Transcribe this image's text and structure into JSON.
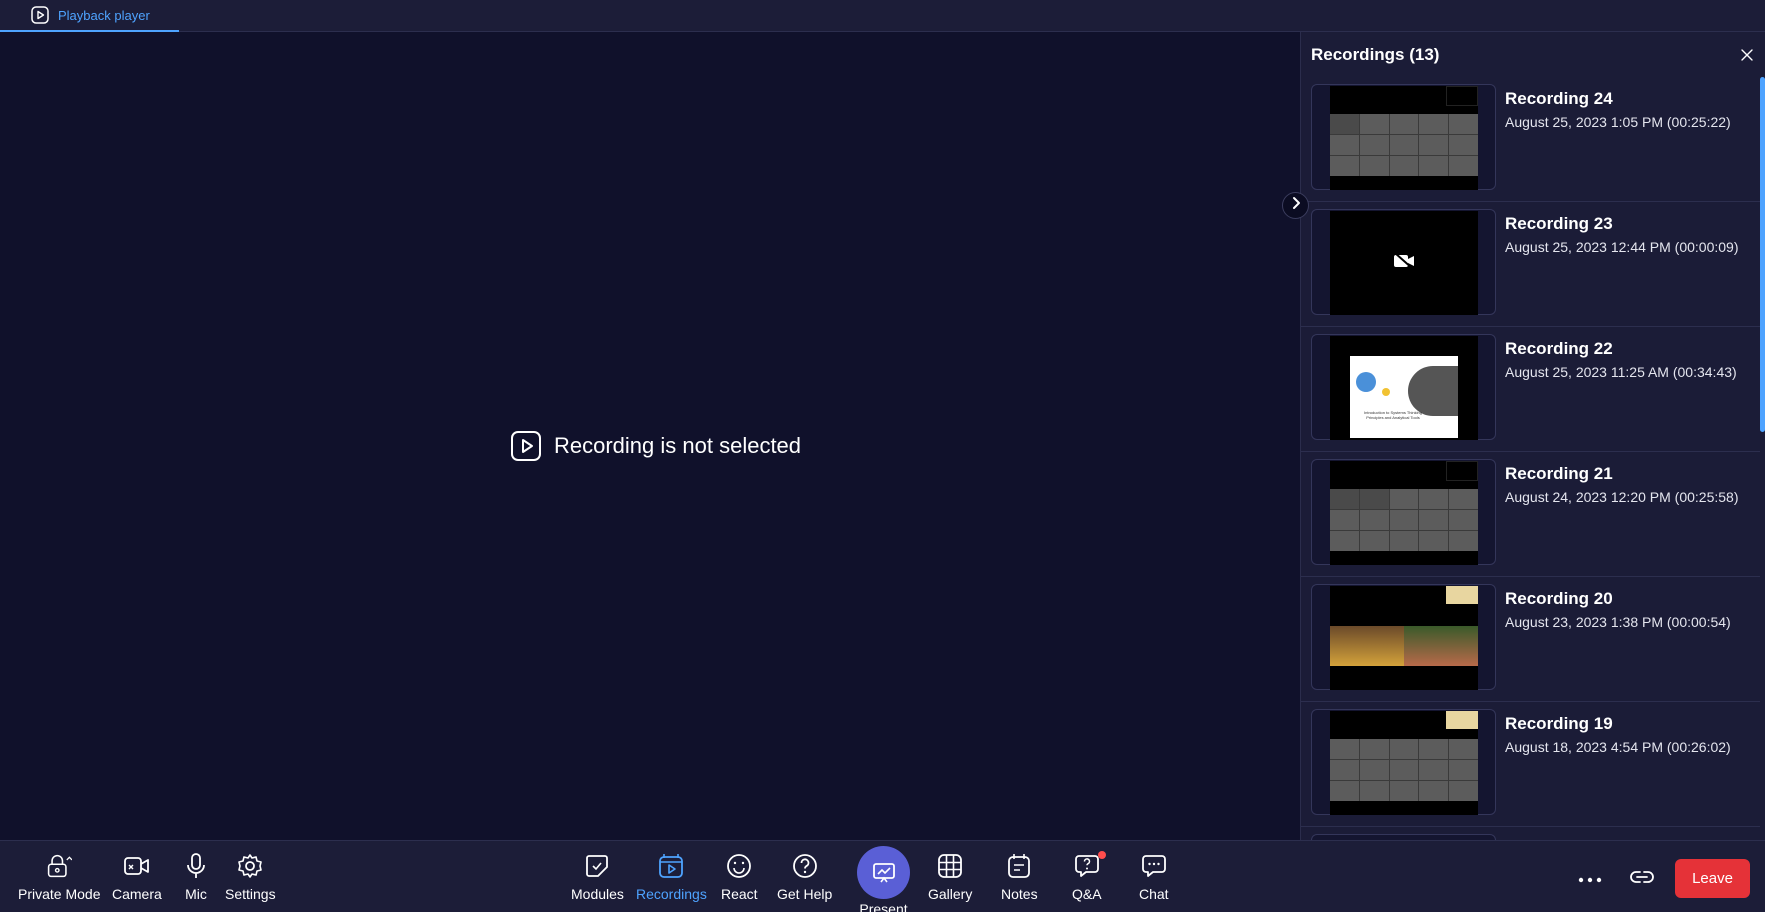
{
  "tabbar": {
    "tab_label": "Playback player"
  },
  "stage": {
    "empty_message": "Recording is not selected"
  },
  "panel": {
    "title": "Recordings (13)",
    "recordings": [
      {
        "name": "Recording 24",
        "date": "August 25, 2023 1:05 PM (00:25:22)"
      },
      {
        "name": "Recording 23",
        "date": "August 25, 2023 12:44 PM (00:00:09)"
      },
      {
        "name": "Recording 22",
        "date": "August 25, 2023 11:25 AM (00:34:43)"
      },
      {
        "name": "Recording 21",
        "date": "August 24, 2023 12:20 PM (00:25:58)"
      },
      {
        "name": "Recording 20",
        "date": "August 23, 2023 1:38 PM (00:00:54)"
      },
      {
        "name": "Recording 19",
        "date": "August 18, 2023 4:54 PM (00:26:02)"
      }
    ],
    "slide_caption": "Introduction to Systems Thinking Principles and Analytical Tools"
  },
  "toolbar": {
    "private_mode": "Private Mode",
    "camera": "Camera",
    "mic": "Mic",
    "settings": "Settings",
    "modules": "Modules",
    "recordings": "Recordings",
    "react": "React",
    "get_help": "Get Help",
    "present": "Present",
    "gallery": "Gallery",
    "notes": "Notes",
    "qa": "Q&A",
    "chat": "Chat",
    "leave": "Leave"
  },
  "colors": {
    "accent": "#4ea3ff",
    "background": "#10112b",
    "panel": "#1b1c37",
    "leave": "#e53238",
    "present": "#5a5fd6"
  }
}
